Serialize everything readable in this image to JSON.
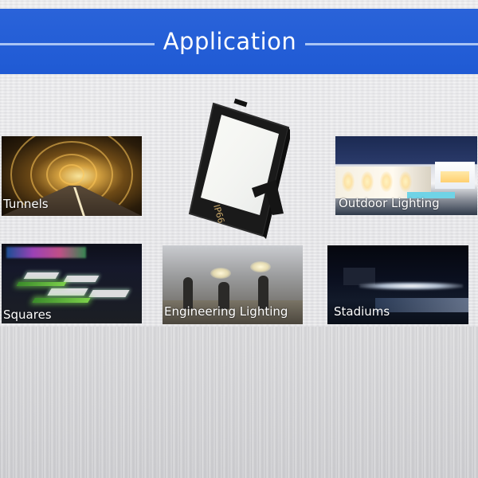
{
  "header": {
    "title": "Application",
    "band_color": "#1f5ad4"
  },
  "product": {
    "icon": "floodlight-icon",
    "housing_color": "#1a1a1a",
    "panel_color": "#f7f8f4",
    "marking": "IP66"
  },
  "applications": [
    {
      "label": "Tunnels"
    },
    {
      "label": "Outdoor Lighting"
    },
    {
      "label": "Squares"
    },
    {
      "label": "Engineering Lighting"
    },
    {
      "label": "Stadiums"
    }
  ]
}
